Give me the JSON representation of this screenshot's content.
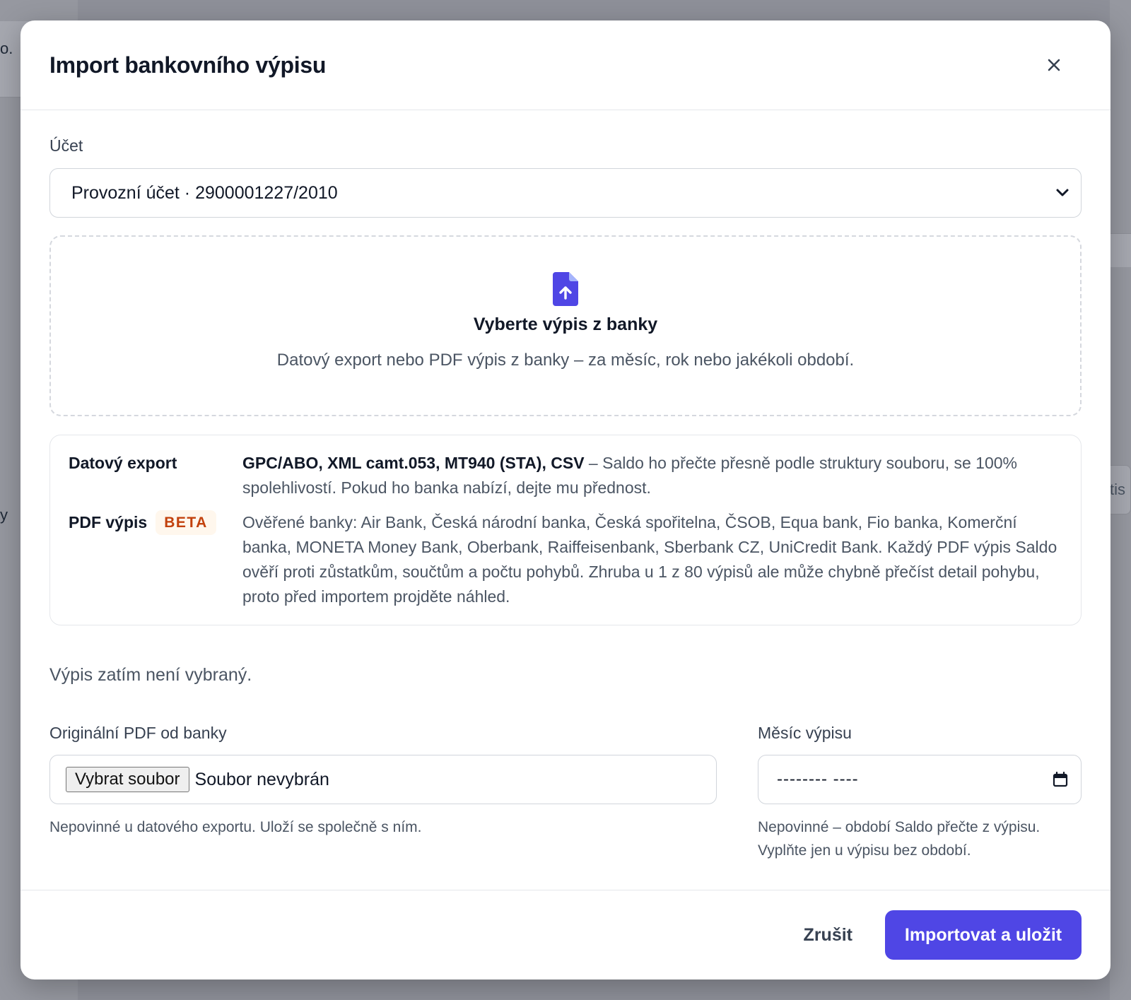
{
  "background": {
    "left_fragment_1": "o.",
    "left_fragment_2": "y",
    "right_fragment": "tis"
  },
  "modal": {
    "title": "Import bankovního výpisu",
    "close_label": "×"
  },
  "account": {
    "label": "Účet",
    "selected": "Provozní účet · 2900001227/2010"
  },
  "dropzone": {
    "icon": "file-upload-icon",
    "title": "Vyberte výpis z banky",
    "subtitle": "Datový export nebo PDF výpis z banky – za měsíc, rok nebo jakékoli období."
  },
  "info": {
    "data_export": {
      "term": "Datový export",
      "formats": "GPC/ABO, XML camt.053, MT940 (STA), CSV",
      "text": " – Saldo ho přečte přesně podle struktury souboru, se 100% spolehlivostí. Pokud ho banka nabízí, dejte mu přednost."
    },
    "pdf": {
      "term": "PDF výpis",
      "badge": "BETA",
      "text": "Ověřené banky: Air Bank, Česká národní banka, Česká spořitelna, ČSOB, Equa bank, Fio banka, Komerční banka, MONETA Money Bank, Oberbank, Raiffeisenbank, Sberbank CZ, UniCredit Bank. Každý PDF výpis Saldo ověří proti zůstatkům, součtům a počtu pohybů. Zhruba u 1 z 80 výpisů ale může chybně přečíst detail pohybu, proto před importem projděte náhled."
    }
  },
  "status": "Výpis zatím není vybraný.",
  "pdf_field": {
    "label": "Originální PDF od banky",
    "button": "Vybrat soubor",
    "file_name": "Soubor nevybrán",
    "hint": "Nepovinné u datového exportu. Uloží se společně s ním."
  },
  "month_field": {
    "label": "Měsíc výpisu",
    "placeholder": "-------- ----",
    "hint_line1": "Nepovinné – období Saldo přečte z výpisu.",
    "hint_line2": "Vyplňte jen u výpisu bez období."
  },
  "footer": {
    "cancel": "Zrušit",
    "submit": "Importovat a uložit"
  },
  "colors": {
    "accent": "#4f46e5",
    "badge_bg": "#fff7ed",
    "badge_text": "#c2410c"
  }
}
